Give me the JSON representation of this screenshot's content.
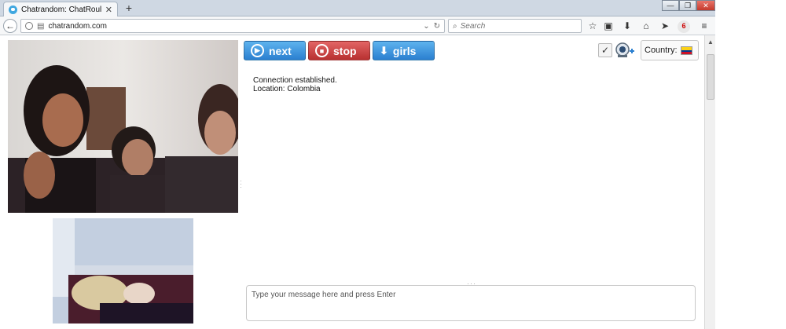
{
  "browser": {
    "tab_title": "Chatrandom: ChatRoulette...",
    "tab_close": "✕",
    "new_tab": "+",
    "url": "chatrandom.com",
    "search_placeholder": "Search",
    "window_controls": {
      "minimize": "—",
      "maximize": "❐",
      "close": "✕"
    },
    "icons": [
      "star-icon",
      "clipboard-icon",
      "download-icon",
      "home-icon",
      "send-icon",
      "notification-badge-icon",
      "menu-icon"
    ],
    "badge_count": "6"
  },
  "controls": {
    "next_label": "next",
    "stop_label": "stop",
    "girls_label": "girls",
    "country_label": "Country:",
    "flag_colors": [
      "#FCD116",
      "#003893",
      "#CE1126"
    ]
  },
  "chat": {
    "log": [
      "Connection established.",
      "Location: Colombia"
    ],
    "input_placeholder": "Type your message here and press Enter"
  },
  "colors": {
    "next": "#2a7fd0",
    "stop": "#b73030",
    "girls": "#2a7fd0"
  }
}
